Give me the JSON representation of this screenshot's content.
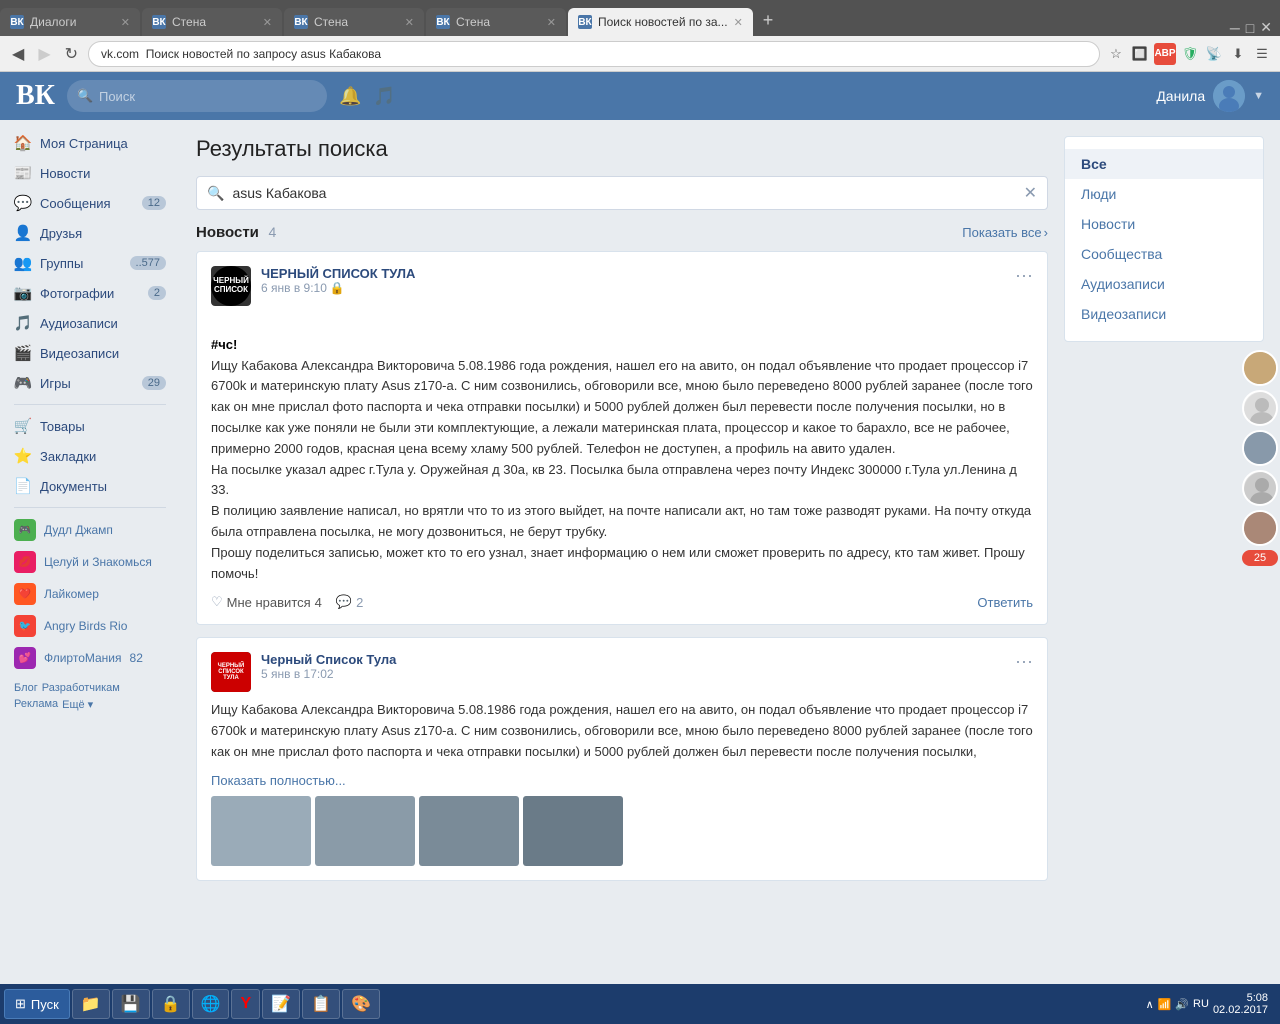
{
  "browser": {
    "tabs": [
      {
        "label": "Диалоги",
        "icon": "vk",
        "active": false,
        "id": "tab-dialogi"
      },
      {
        "label": "Стена",
        "icon": "vk",
        "active": false,
        "id": "tab-stena1"
      },
      {
        "label": "Стена",
        "icon": "vk",
        "active": false,
        "id": "tab-stena2"
      },
      {
        "label": "Стена",
        "icon": "vk",
        "active": false,
        "id": "tab-stena3"
      },
      {
        "label": "Поиск новостей по за...",
        "icon": "vk",
        "active": true,
        "id": "tab-search"
      }
    ],
    "address": "vk.com  Поиск новостей по запросу asus Кабакова"
  },
  "vk": {
    "logo": "ВК",
    "search_placeholder": "Поиск",
    "user_name": "Данила"
  },
  "sidebar": {
    "items": [
      {
        "label": "Моя Страница",
        "icon": "🏠",
        "badge": ""
      },
      {
        "label": "Новости",
        "icon": "📰",
        "badge": ""
      },
      {
        "label": "Сообщения",
        "icon": "💬",
        "badge": "12"
      },
      {
        "label": "Друзья",
        "icon": "👤",
        "badge": ""
      },
      {
        "label": "Группы",
        "icon": "👥",
        "badge": "..577"
      },
      {
        "label": "Фотографии",
        "icon": "📷",
        "badge": "2"
      },
      {
        "label": "Аудиозаписи",
        "icon": "🎵",
        "badge": ""
      },
      {
        "label": "Видеозаписи",
        "icon": "🎬",
        "badge": ""
      },
      {
        "label": "Игры",
        "icon": "🎮",
        "badge": "29"
      }
    ],
    "secondary": [
      {
        "label": "Товары",
        "icon": "🛒"
      },
      {
        "label": "Закладки",
        "icon": "⭐"
      },
      {
        "label": "Документы",
        "icon": "📄"
      }
    ],
    "apps": [
      {
        "label": "Дудл Джамп",
        "color": "#4caf50"
      },
      {
        "label": "Целуй и Знакомься",
        "color": "#e91e63"
      },
      {
        "label": "Лайкомер",
        "color": "#ff5722"
      },
      {
        "label": "Angry Birds Rio",
        "color": "#f44336"
      },
      {
        "label": "ФлиртоМания",
        "color": "#9c27b0",
        "badge": "82"
      }
    ],
    "footer": [
      "Блог",
      "Разработчикам",
      "Реклама",
      "Ещё ▾"
    ]
  },
  "search": {
    "title": "Результаты поиска",
    "query": "asus Кабакова",
    "sections": {
      "news": {
        "label": "Новости",
        "count": "4",
        "show_all": "Показать все"
      }
    }
  },
  "right_filter": {
    "items": [
      "Все",
      "Люди",
      "Новости",
      "Сообщества",
      "Аудиозаписи",
      "Видеозаписи"
    ],
    "active": "Все"
  },
  "posts": [
    {
      "id": "post1",
      "author": "ЧЕРНЫЙ СПИСОК ТУЛА",
      "time": "6 янв в 9:10",
      "avatar_type": "black",
      "avatar_text": "ЧЕРНЫЙ СПИСОК",
      "body": "#чс!\nИщу Кабакова Александра Викторовича 5.08.1986 года рождения, нашел его на авито, он подал объявление что продает процессор i7 6700k и материнскую плату Asus z170-а. С ним созвонились, обговорили все, мною было переведено 8000 рублей заранее (после того как он мне прислал фото паспорта и чека отправки посылки) и 5000 рублей должен был перевести после получения посылки, но в посылке как уже поняли не были эти комплектующие, а лежали материнская плата, процессор и какое то барахло, все не рабочее, примерно 2000 годов, красная цена всему хламу 500 рублей. Телефон не доступен, а профиль на авито удален.\nНа посылке указал адрес г.Тула у. Оружейная д 30а, кв 23. Посылка была отправлена через почту Индекс 300000 г.Тула ул.Ленина д 33.\nВ полицию заявление написал, но врятли что то из этого выйдет, на почте написали акт, но там тоже разводят руками. На почту откуда была отправлена посылка, не могу дозвониться, не берут трубку.\nПрошу поделиться записью, может кто то его узнал, знает информацию о нем или сможет проверить по адресу, кто там живет. Прошу помочь!",
      "likes": "4",
      "comments": "2",
      "reply": "Ответить"
    },
    {
      "id": "post2",
      "author": "Черный Список Тула",
      "time": "5 янв в 17:02",
      "avatar_type": "danger",
      "avatar_text": "ЧЕРНЫЙ СПИСОК ТУЛА",
      "body": "Ищу Кабакова Александра Викторовича 5.08.1986 года рождения, нашел его на авито, он подал объявление что продает процессор i7 6700k и материнскую плату Asus z170-а. С ним созвонились, обговорили все, мною было переведено 8000 рублей заранее (после того как он мне прислал фото паспорта и чека отправки посылки) и 5000 рублей должен был перевести после получения посылки,",
      "read_more": "Показать полностью...",
      "has_images": true
    }
  ],
  "taskbar": {
    "start_label": "Пуск",
    "apps": [
      "📁",
      "💾",
      "🔒",
      "🌐",
      "Y",
      "📝",
      "📋",
      "🎨"
    ],
    "tray": {
      "lang": "RU",
      "time": "5:08",
      "date": "02.02.2017"
    }
  },
  "strip_count": "25"
}
